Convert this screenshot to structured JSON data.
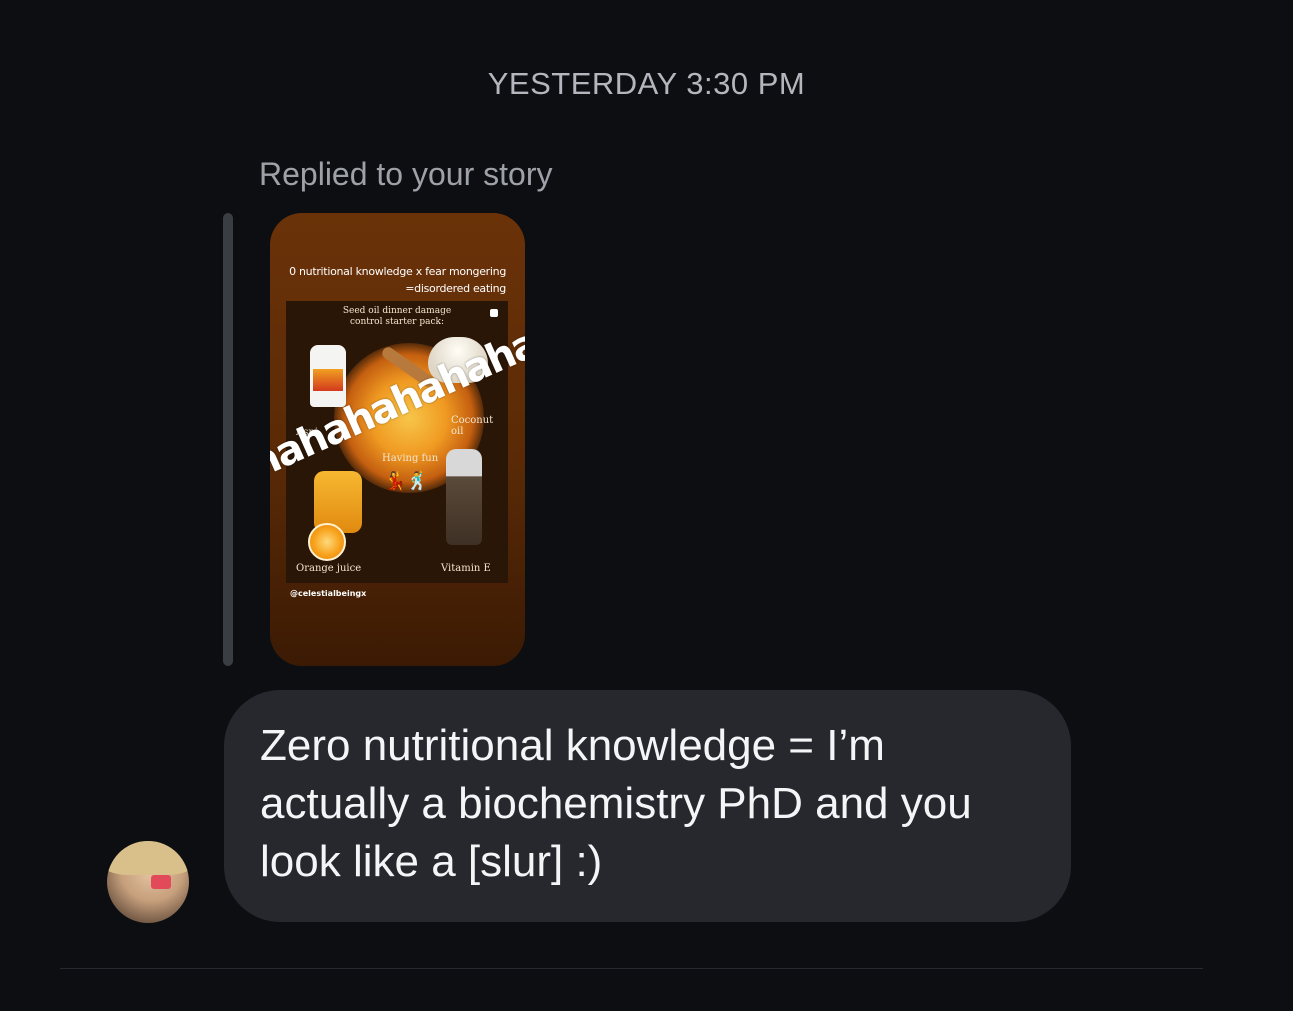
{
  "thread": {
    "timestamp": "YESTERDAY 3:30 PM"
  },
  "story_reply": {
    "label": "Replied to your story",
    "caption_line1": "0 nutritional knowledge x fear mongering",
    "caption_line2": "=disordered eating",
    "card": {
      "title_line1": "Seed oil dinner damage",
      "title_line2": "control starter pack:",
      "labels": {
        "aspirin": "Aspi",
        "coconut": "Coconut oil",
        "having_fun": "Having fun",
        "orange_juice": "Orange juice",
        "vitamin_e": "Vitamin E"
      },
      "dancers": "💃🕺"
    },
    "handle": "@celestialbeingx",
    "sticker_text": "hahahahahaha"
  },
  "message": {
    "text": "Zero nutritional knowledge = I’m actually a biochemistry PhD and you look like a [slur] :)"
  },
  "colors": {
    "background": "#0c0e12",
    "bubble": "#26282d",
    "muted_text": "#9ea2a8"
  }
}
